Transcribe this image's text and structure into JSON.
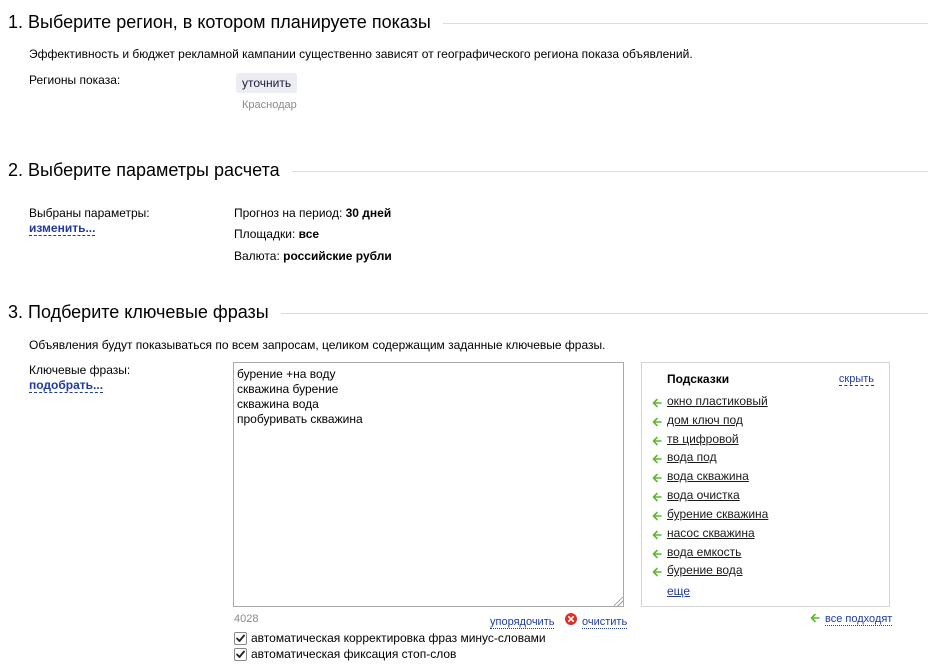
{
  "section1": {
    "title": "1. Выберите регион, в котором планируете показы",
    "description": "Эффективность и бюджет рекламной кампании существенно зависят от географического региона показа объявлений.",
    "regions_label": "Регионы показа:",
    "refine_button": "уточнить",
    "region_value": "Краснодар"
  },
  "section2": {
    "title": "2. Выберите параметры расчета",
    "selected_label": "Выбраны параметры:",
    "change_link": "изменить...",
    "params": [
      {
        "label": "Прогноз на период: ",
        "value": "30 дней"
      },
      {
        "label": "Площадки: ",
        "value": "все"
      },
      {
        "label": "Валюта: ",
        "value": "российские рубли"
      }
    ]
  },
  "section3": {
    "title": "3. Подберите ключевые фразы",
    "description": "Объявления будут показываться по всем запросам, целиком содержащим заданные ключевые фразы.",
    "keywords_label": "Ключевые фразы:",
    "pick_link": "подобрать...",
    "keywords_text": "бурение +на воду\nскважина бурение\nскважина вода\nпробуривать скважина",
    "char_count": "4028",
    "order_link": "упорядочить",
    "clear_link": "очистить",
    "hints": {
      "title": "Подсказки",
      "hide_link": "скрыть",
      "items": [
        "окно пластиковый",
        "дом ключ под",
        "тв цифровой",
        "вода под",
        "вода скважина",
        "вода очистка",
        "бурение скважина",
        "насос скважина",
        "вода емкость",
        "бурение вода"
      ],
      "more_link": "еще",
      "all_fit_link": "все подходят"
    },
    "checkboxes": [
      {
        "label": "автоматическая корректировка фраз минус-словами",
        "checked": true
      },
      {
        "label": "автоматическая фиксация стоп-слов",
        "checked": true
      }
    ]
  },
  "colors": {
    "link": "#1f3aa8",
    "arrow_green": "#5cb82e",
    "clear_red": "#e0302a",
    "rule": "#dcdcdc"
  }
}
